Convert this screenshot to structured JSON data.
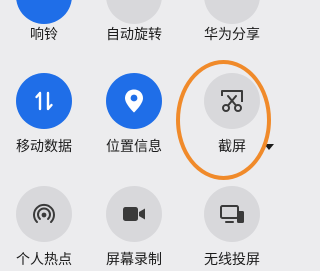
{
  "row1": [
    {
      "label": "响铃",
      "icon": "bell-icon"
    },
    {
      "label": "自动旋转",
      "icon": "auto-rotate-icon"
    },
    {
      "label": "华为分享",
      "icon": "huawei-share-icon"
    }
  ],
  "row2": [
    {
      "label": "移动数据",
      "icon": "mobile-data-icon",
      "state": "on"
    },
    {
      "label": "位置信息",
      "icon": "location-icon",
      "state": "on"
    },
    {
      "label": "截屏",
      "icon": "screenshot-icon",
      "state": "off"
    }
  ],
  "row3": [
    {
      "label": "个人热点",
      "icon": "hotspot-icon",
      "state": "off"
    },
    {
      "label": "屏幕录制",
      "icon": "screen-record-icon",
      "state": "off"
    },
    {
      "label": "无线投屏",
      "icon": "wireless-projection-icon",
      "state": "off"
    }
  ],
  "colors": {
    "accent": "#1f6ee8",
    "tile_off": "#d8d8db",
    "highlight": "#f08a2a",
    "background": "#ececee"
  }
}
